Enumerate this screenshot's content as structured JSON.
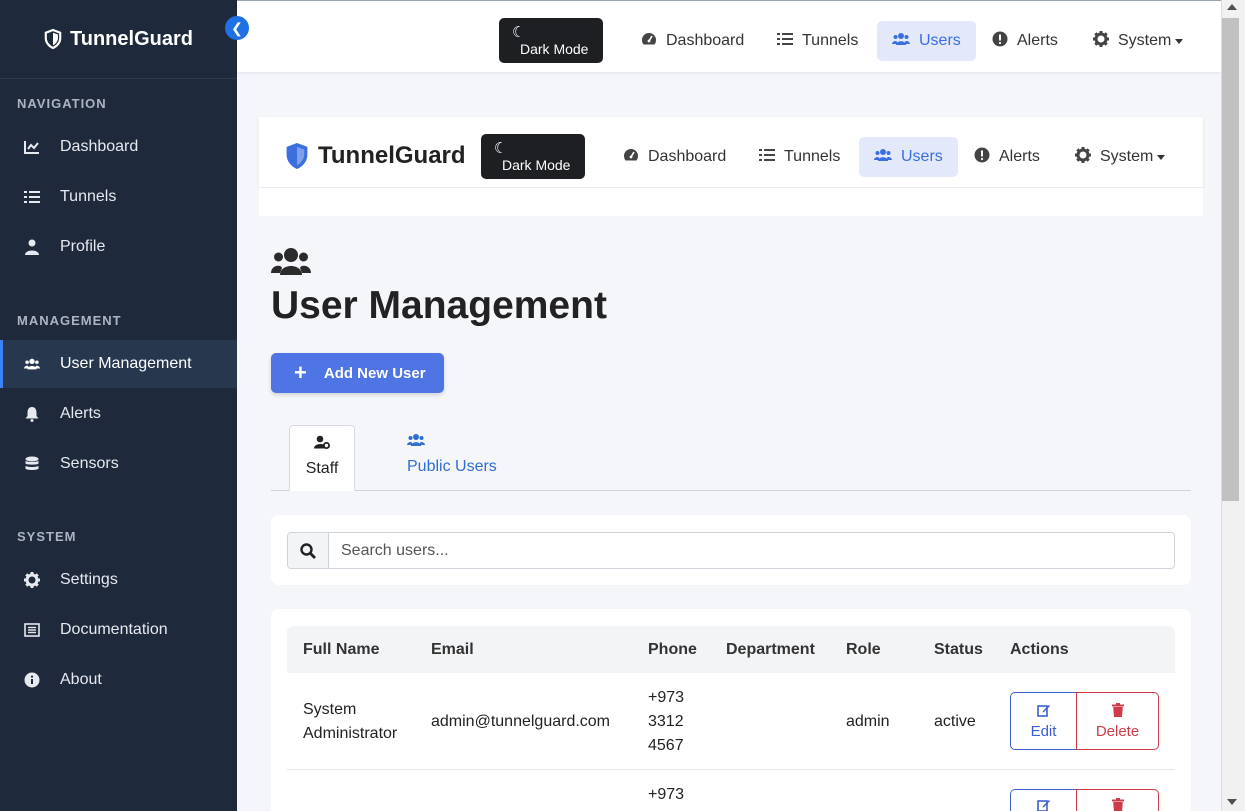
{
  "app": {
    "name": "TunnelGuard",
    "brand_color": "#3b6fe0"
  },
  "sidebar": {
    "sections": [
      {
        "title": "NAVIGATION",
        "items": [
          {
            "label": "Dashboard",
            "icon": "chart-line-icon"
          },
          {
            "label": "Tunnels",
            "icon": "list-icon"
          },
          {
            "label": "Profile",
            "icon": "user-icon"
          }
        ]
      },
      {
        "title": "MANAGEMENT",
        "items": [
          {
            "label": "User Management",
            "icon": "users-icon",
            "active": true
          },
          {
            "label": "Alerts",
            "icon": "bell-icon"
          },
          {
            "label": "Sensors",
            "icon": "database-icon"
          }
        ]
      },
      {
        "title": "SYSTEM",
        "items": [
          {
            "label": "Settings",
            "icon": "gear-icon"
          },
          {
            "label": "Documentation",
            "icon": "book-icon"
          },
          {
            "label": "About",
            "icon": "info-icon"
          }
        ]
      }
    ]
  },
  "topbar": {
    "dark_mode_label": "Dark Mode",
    "nav": [
      {
        "label": "Dashboard",
        "icon": "gauge-icon"
      },
      {
        "label": "Tunnels",
        "icon": "list-icon"
      },
      {
        "label": "Users",
        "icon": "users-icon",
        "active": true
      },
      {
        "label": "Alerts",
        "icon": "alert-icon"
      },
      {
        "label": "System",
        "icon": "gear-icon",
        "dropdown": true
      }
    ]
  },
  "page": {
    "title": "User Management",
    "add_button_label": "Add New User",
    "tabs": [
      {
        "label": "Staff",
        "icon": "user-gear-icon",
        "active": true
      },
      {
        "label": "Public Users",
        "icon": "users-icon"
      }
    ],
    "search": {
      "placeholder": "Search users..."
    },
    "table": {
      "columns": [
        "Full Name",
        "Email",
        "Phone",
        "Department",
        "Role",
        "Status",
        "Actions"
      ],
      "rows": [
        {
          "full_name_line1": "System",
          "full_name_line2": "Administrator",
          "email": "admin@tunnelguard.com",
          "phone_line1": "+973",
          "phone_line2": "3312",
          "phone_line3": "4567",
          "department": "",
          "role": "admin",
          "status": "active"
        },
        {
          "phone_line1": "+973"
        }
      ],
      "edit_label": "Edit",
      "delete_label": "Delete"
    }
  }
}
